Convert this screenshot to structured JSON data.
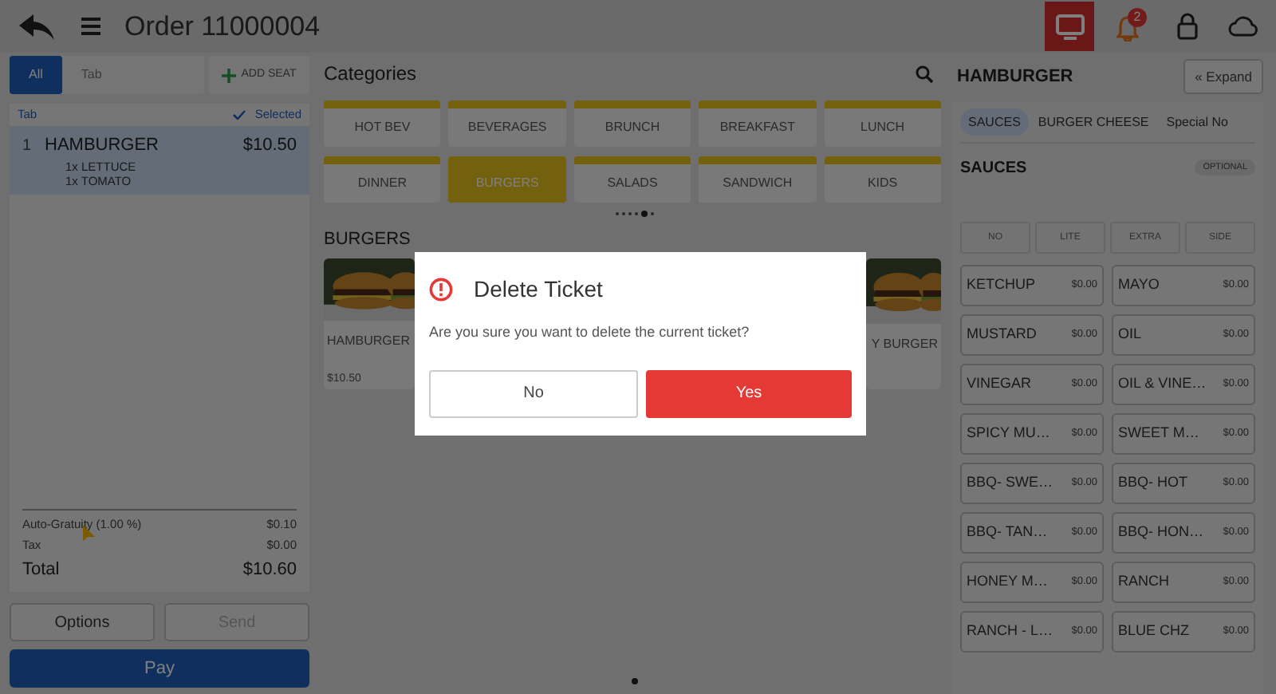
{
  "top_bar": {
    "title": "Order 11000004",
    "notification_count": "2"
  },
  "ticket": {
    "seat_tabs": [
      {
        "label": "All",
        "selected": true
      },
      {
        "label": "Tab",
        "selected": false
      }
    ],
    "add_seat": "ADD SEAT",
    "list_header": "Tab",
    "selected_label": "Selected",
    "items": [
      {
        "seat": "1",
        "name": "HAMBURGER",
        "price": "$10.50",
        "selected": true,
        "modifiers": [
          "1x LETTUCE",
          "1x TOMATO"
        ]
      }
    ],
    "summary": [
      {
        "label": "Auto-Gratuity (1.00 %)",
        "amount": "$0.10"
      },
      {
        "label": "Tax",
        "amount": "$0.00"
      }
    ],
    "total": {
      "label": "Total",
      "amount": "$10.60"
    },
    "buttons": [
      {
        "label": "Options",
        "disabled": false
      },
      {
        "label": "Send",
        "disabled": true
      }
    ],
    "pay": "Pay"
  },
  "menu": {
    "title": "Categories",
    "categories": [
      {
        "label": "HOT BEV",
        "selected": false
      },
      {
        "label": "BEVERAGES",
        "selected": false
      },
      {
        "label": "BRUNCH",
        "selected": false
      },
      {
        "label": "BREAKFAST",
        "selected": false
      },
      {
        "label": "LUNCH",
        "selected": false
      },
      {
        "label": "DINNER",
        "selected": false
      },
      {
        "label": "BURGERS",
        "selected": true
      },
      {
        "label": "SALADS",
        "selected": false
      },
      {
        "label": "SANDWICH",
        "selected": false
      },
      {
        "label": "KIDS",
        "selected": false
      }
    ],
    "page_dots": [
      {
        "selected": false
      },
      {
        "selected": false
      },
      {
        "selected": false
      },
      {
        "selected": false
      },
      {
        "selected": true
      },
      {
        "selected": false
      }
    ],
    "section": "BURGERS",
    "products": [
      {
        "name": "HAMBURGER",
        "price": "$10.50"
      },
      {
        "name": "Y BURGER"
      }
    ]
  },
  "modifiers_panel": {
    "title": "HAMBURGER",
    "expand": "« Expand",
    "tabs": [
      {
        "label": "SAUCES",
        "selected": true
      },
      {
        "label": "BURGER CHEESE",
        "selected": false
      },
      {
        "label": "Special No",
        "selected": false
      }
    ],
    "group": "SAUCES",
    "badge": "OPTIONAL",
    "portions": [
      "NO",
      "LITE",
      "EXTRA",
      "SIDE"
    ],
    "options": [
      {
        "name": "KETCHUP",
        "price": "$0.00"
      },
      {
        "name": "MAYO",
        "price": "$0.00"
      },
      {
        "name": "MUSTARD",
        "price": "$0.00"
      },
      {
        "name": "OIL",
        "price": "$0.00"
      },
      {
        "name": "VINEGAR",
        "price": "$0.00"
      },
      {
        "name": "OIL & VINE…",
        "price": "$0.00"
      },
      {
        "name": "SPICY MU…",
        "price": "$0.00"
      },
      {
        "name": "SWEET M…",
        "price": "$0.00"
      },
      {
        "name": "BBQ- SWE…",
        "price": "$0.00"
      },
      {
        "name": "BBQ- HOT",
        "price": "$0.00"
      },
      {
        "name": "BBQ- TAN…",
        "price": "$0.00"
      },
      {
        "name": "BBQ- HON…",
        "price": "$0.00"
      },
      {
        "name": "HONEY M…",
        "price": "$0.00"
      },
      {
        "name": "RANCH",
        "price": "$0.00"
      },
      {
        "name": "RANCH - L…",
        "price": "$0.00"
      },
      {
        "name": "BLUE CHZ",
        "price": "$0.00"
      }
    ]
  },
  "dialog": {
    "title": "Delete Ticket",
    "message": "Are you sure you want to delete the current ticket?",
    "buttons": [
      {
        "label": "No",
        "kind": "secondary"
      },
      {
        "label": "Yes",
        "kind": "primary"
      }
    ]
  }
}
